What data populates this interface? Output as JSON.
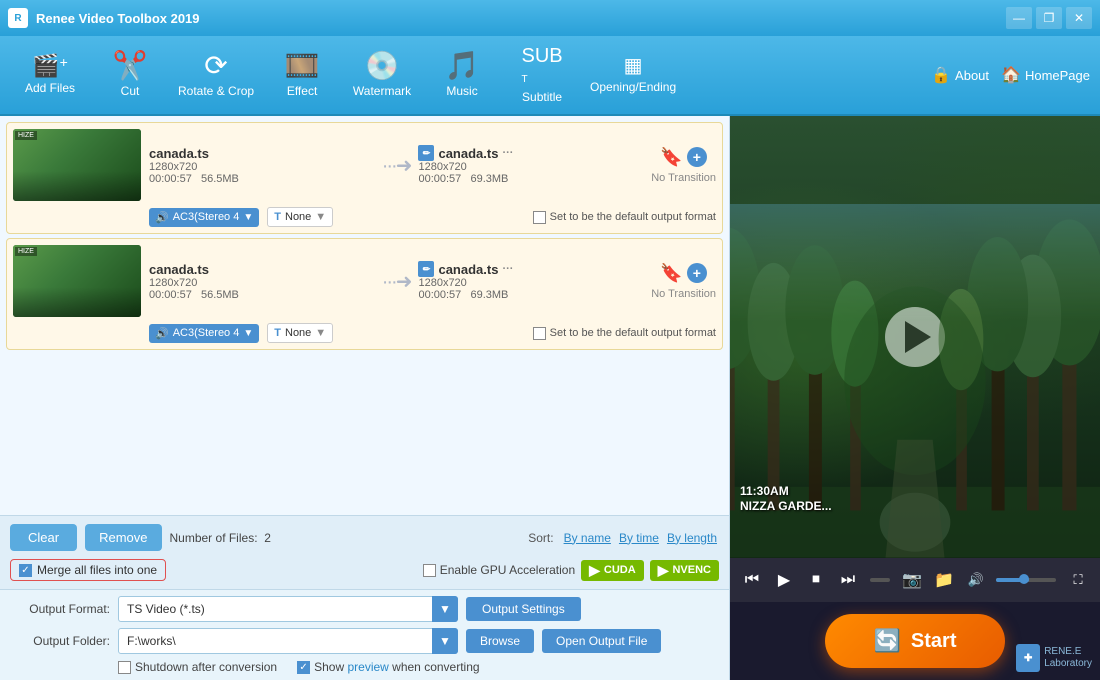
{
  "app": {
    "title": "Renee Video Toolbox 2019",
    "logo_text": "R"
  },
  "titlebar": {
    "minimize": "—",
    "restore": "❐",
    "close": "✕"
  },
  "toolbar": {
    "add_files": "Add Files",
    "cut": "Cut",
    "rotate_crop": "Rotate & Crop",
    "effect": "Effect",
    "watermark": "Watermark",
    "music": "Music",
    "subtitle": "Subtitle",
    "opening_ending": "Opening/Ending",
    "about": "About",
    "homepage": "HomePage"
  },
  "files": [
    {
      "name": "canada.ts",
      "resolution": "1280x720",
      "duration": "00:00:57",
      "size": "56.5MB",
      "output_name": "canada.ts",
      "output_resolution": "1280x720",
      "output_duration": "00:00:57",
      "output_size": "69.3MB",
      "transition": "No Transition",
      "audio": "AC3(Stereo 4",
      "subtitle": "None"
    },
    {
      "name": "canada.ts",
      "resolution": "1280x720",
      "duration": "00:00:57",
      "size": "56.5MB",
      "output_name": "canada.ts",
      "output_resolution": "1280x720",
      "output_duration": "00:00:57",
      "output_size": "69.3MB",
      "transition": "No Transition",
      "audio": "AC3(Stereo 4",
      "subtitle": "None"
    }
  ],
  "bottom_bar": {
    "clear_label": "Clear",
    "remove_label": "Remove",
    "file_count_prefix": "Number of Files:",
    "file_count": "2",
    "sort_label": "Sort:",
    "sort_by_name": "By name",
    "sort_by_time": "By time",
    "sort_by_length": "By length",
    "merge_label": "Merge all files into one",
    "enable_gpu": "Enable GPU Acceleration",
    "cuda": "CUDA",
    "nvenc": "NVENC"
  },
  "output": {
    "format_label": "Output Format:",
    "format_value": "TS Video (*.ts)",
    "settings_btn": "Output Settings",
    "folder_label": "Output Folder:",
    "folder_value": "F:\\works\\",
    "browse_btn": "Browse",
    "open_output_btn": "Open Output File",
    "shutdown_label": "Shutdown after conversion",
    "show_preview_label": "Show",
    "preview_link": "preview",
    "show_preview_suffix": "when converting"
  },
  "video_overlay": {
    "time": "11:30AM",
    "location": "NIZZA GARDE..."
  },
  "start_btn": "Start",
  "renee": {
    "line1": "RENE.E",
    "line2": "Laboratory"
  }
}
